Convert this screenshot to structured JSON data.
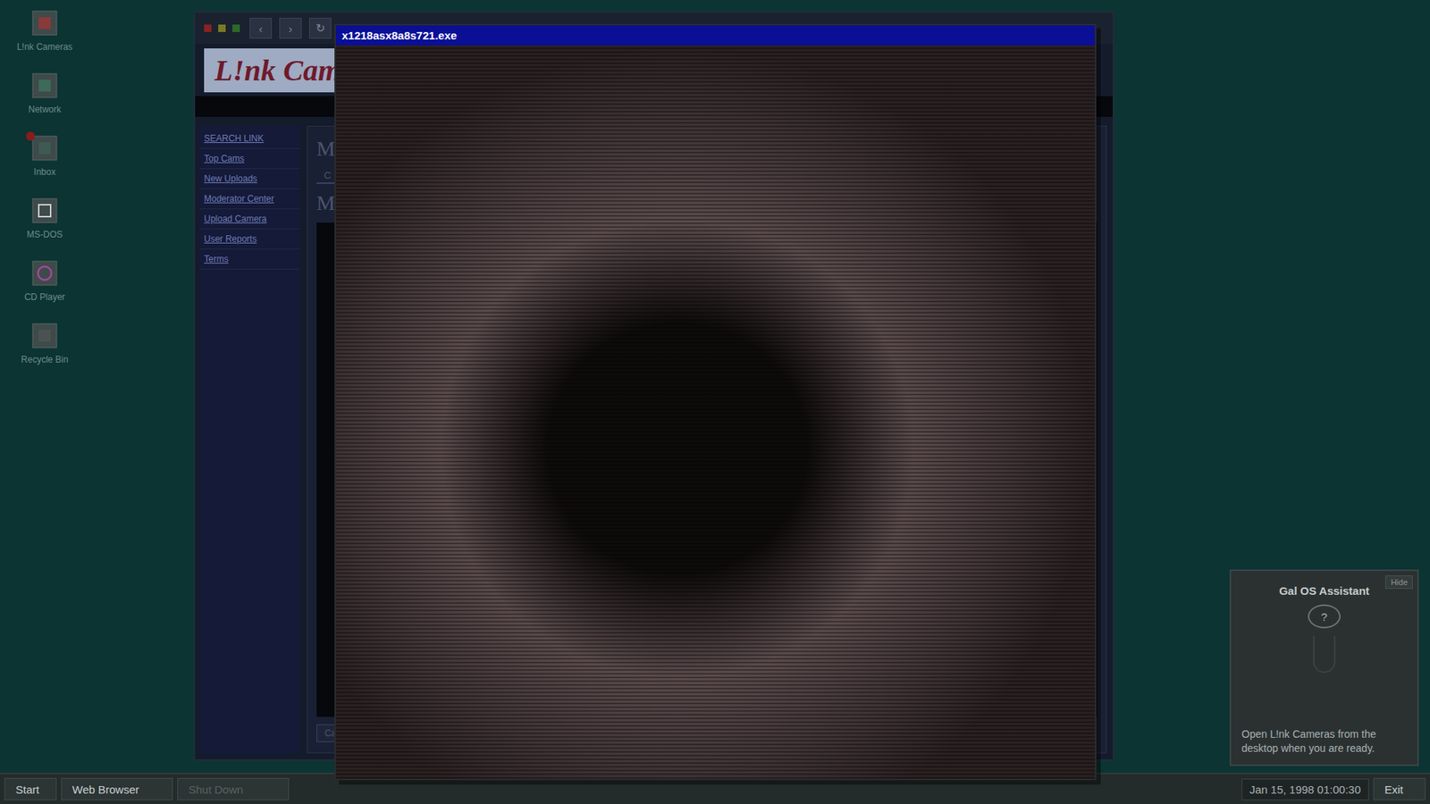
{
  "desktop_icons": [
    {
      "label": "L!nk Cameras",
      "kind": "cameras",
      "unread": false
    },
    {
      "label": "Network",
      "kind": "network",
      "unread": false
    },
    {
      "label": "Inbox",
      "kind": "inbox",
      "unread": true
    },
    {
      "label": "MS-DOS",
      "kind": "dos",
      "unread": false
    },
    {
      "label": "CD Player",
      "kind": "cd",
      "unread": false
    },
    {
      "label": "Recycle Bin",
      "kind": "trash",
      "unread": false
    }
  ],
  "browser": {
    "controls": [
      "‹",
      "›",
      "↻"
    ],
    "logo": "L!nk Cam",
    "sidebar": [
      "SEARCH LINK",
      "Top Cams",
      "New Uploads",
      "Moderator Center",
      "Upload Camera",
      "User Reports",
      "Terms"
    ],
    "headings": [
      "M",
      "M"
    ],
    "tab": "C",
    "button": "Ca"
  },
  "popup": {
    "title": "x1218asx8a8s721.exe"
  },
  "assistant": {
    "title": "Gal OS Assistant",
    "hide": "Hide",
    "icon": "?",
    "message": "Open L!nk Cameras from the desktop when you are ready."
  },
  "taskbar": {
    "start": "Start",
    "items": [
      {
        "label": "Web Browser",
        "disabled": false
      },
      {
        "label": "Shut Down",
        "disabled": true
      }
    ],
    "clock": "Jan 15, 1998 01:00:30",
    "exit": "Exit"
  }
}
